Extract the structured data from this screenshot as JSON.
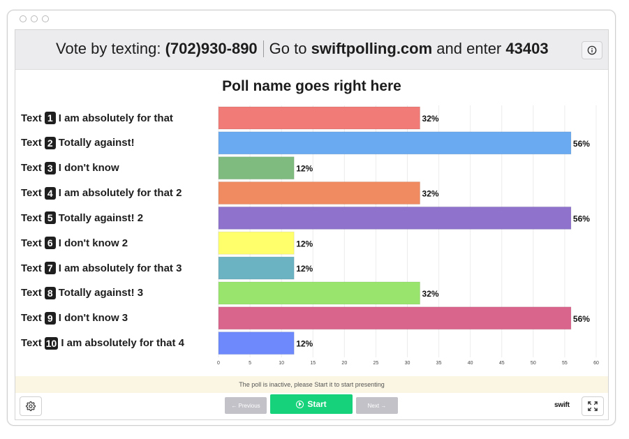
{
  "header": {
    "vote_prefix": "Vote by texting:",
    "phone": "(702)930-890",
    "goto_prefix": "Go to",
    "site": "swiftpolling.com",
    "enter_text": "and enter",
    "code": "43403"
  },
  "option_prefix": "Text",
  "options": [
    {
      "num": "1",
      "label": "I am absolutely for that"
    },
    {
      "num": "2",
      "label": "Totally against!"
    },
    {
      "num": "3",
      "label": "I don't know"
    },
    {
      "num": "4",
      "label": "I am absolutely for that 2"
    },
    {
      "num": "5",
      "label": "Totally against! 2"
    },
    {
      "num": "6",
      "label": "I don't know 2"
    },
    {
      "num": "7",
      "label": "I am absolutely for that 3"
    },
    {
      "num": "8",
      "label": "Totally against! 3"
    },
    {
      "num": "9",
      "label": "I don't know 3"
    },
    {
      "num": "10",
      "label": "I am absolutely for that 4"
    }
  ],
  "chart_data": {
    "type": "bar",
    "orientation": "horizontal",
    "title": "Poll name goes right here",
    "categories": [
      "I am absolutely for that",
      "Totally against!",
      "I don't know",
      "I am absolutely for that 2",
      "Totally against! 2",
      "I don't know 2",
      "I am absolutely for that 3",
      "Totally against! 3",
      "I don't know 3",
      "I am absolutely for that 4"
    ],
    "values": [
      32,
      56,
      12,
      32,
      56,
      12,
      12,
      32,
      56,
      12
    ],
    "value_labels": [
      "32%",
      "56%",
      "12%",
      "32%",
      "56%",
      "12%",
      "12%",
      "32%",
      "56%",
      "12%"
    ],
    "colors": [
      "#f07b77",
      "#6aaaf0",
      "#7fbb7e",
      "#f08a60",
      "#8e72cc",
      "#ffff6c",
      "#6bb3c3",
      "#98e46c",
      "#d9648c",
      "#6d89fb"
    ],
    "xlim": [
      0,
      60
    ],
    "xticks": [
      "0",
      "5",
      "10",
      "15",
      "20",
      "25",
      "30",
      "35",
      "40",
      "45",
      "50",
      "55",
      "60"
    ],
    "grid": true,
    "legend": "none"
  },
  "status_message": "The poll is inactive, please Start it to start presenting",
  "controls": {
    "previous": "← Previous",
    "start": "Start",
    "next": "Next →",
    "logo": "swift"
  },
  "icons": {
    "info": "info-icon",
    "settings": "gear-icon",
    "fullscreen": "expand-icon",
    "start": "play-circle-icon"
  }
}
